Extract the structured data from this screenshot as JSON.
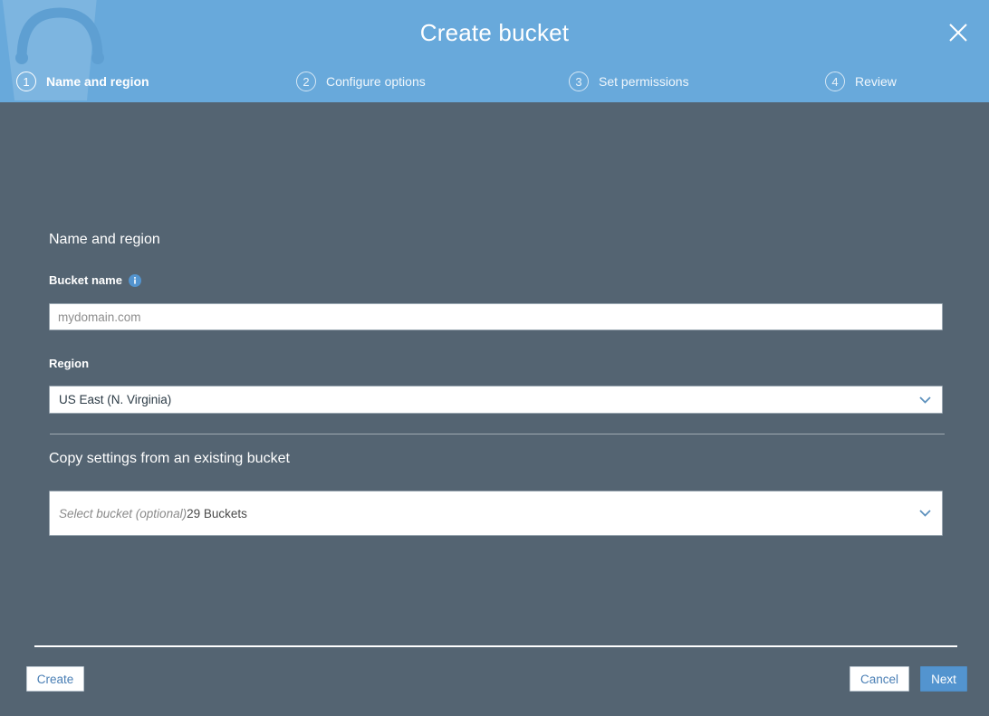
{
  "header": {
    "title": "Create bucket",
    "close_icon": "close-icon",
    "watermark": "bucket-watermark",
    "background_color": "#68A9DB",
    "steps": [
      {
        "number": "1",
        "label": "Name and region",
        "active": true
      },
      {
        "number": "2",
        "label": "Configure options",
        "active": false
      },
      {
        "number": "3",
        "label": "Set permissions",
        "active": false
      },
      {
        "number": "4",
        "label": "Review",
        "active": false
      }
    ]
  },
  "body": {
    "background_color": "#546472",
    "section_name_region": {
      "heading": "Name and region",
      "bucket_name": {
        "label": "Bucket name",
        "info_icon": "info-icon",
        "value": "",
        "placeholder": "mydomain.com"
      },
      "region": {
        "label": "Region",
        "value": "US East (N. Virginia)",
        "chevron_icon": "chevron-down-icon"
      }
    },
    "section_copy_settings": {
      "heading": "Copy settings from an existing bucket",
      "select": {
        "placeholder": "Select bucket (optional)",
        "count_label": "29 Buckets",
        "chevron_icon": "chevron-down-icon"
      }
    }
  },
  "footer": {
    "create_label": "Create",
    "cancel_label": "Cancel",
    "next_label": "Next",
    "primary_color": "#5394cf",
    "link_color": "#4a7fb5"
  }
}
